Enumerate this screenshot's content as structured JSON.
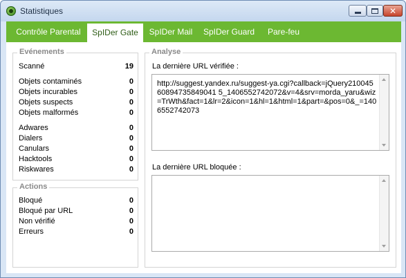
{
  "window": {
    "title": "Statistiques"
  },
  "tabs": [
    {
      "label": "Contrôle Parental"
    },
    {
      "label": "SpIDer Gate"
    },
    {
      "label": "SpIDer Mail"
    },
    {
      "label": "SpIDer Guard"
    },
    {
      "label": "Pare-feu"
    }
  ],
  "active_tab": "SpIDer Gate",
  "events": {
    "title": "Evénements",
    "scanned": {
      "label": "Scanné",
      "value": "19"
    },
    "group1": [
      {
        "label": "Objets contaminés",
        "value": "0"
      },
      {
        "label": "Objets incurables",
        "value": "0"
      },
      {
        "label": "Objets suspects",
        "value": "0"
      },
      {
        "label": "Objets malformés",
        "value": "0"
      }
    ],
    "group2": [
      {
        "label": "Adwares",
        "value": "0"
      },
      {
        "label": "Dialers",
        "value": "0"
      },
      {
        "label": "Canulars",
        "value": "0"
      },
      {
        "label": "Hacktools",
        "value": "0"
      },
      {
        "label": "Riskwares",
        "value": "0"
      }
    ]
  },
  "actions": {
    "title": "Actions",
    "items": [
      {
        "label": "Bloqué",
        "value": "0"
      },
      {
        "label": "Bloqué par URL",
        "value": "0"
      },
      {
        "label": "Non vérifié",
        "value": "0"
      },
      {
        "label": "Erreurs",
        "value": "0"
      }
    ]
  },
  "analysis": {
    "title": "Analyse",
    "last_checked_label": "La dernière URL vérifiée :",
    "last_checked_value": "http://suggest.yandex.ru/suggest-ya.cgi?callback=jQuery21004560894735849041 5_1406552742072&v=4&srv=morda_yaru&wiz=TrWth&fact=1&lr=2&icon=1&hl=1&html=1&part=&pos=0&_=1406552742073",
    "last_blocked_label": "La dernière URL bloquée :",
    "last_blocked_value": ""
  },
  "colors": {
    "tab_bar": "#6cb832",
    "active_tab_text": "#2f5d17"
  }
}
